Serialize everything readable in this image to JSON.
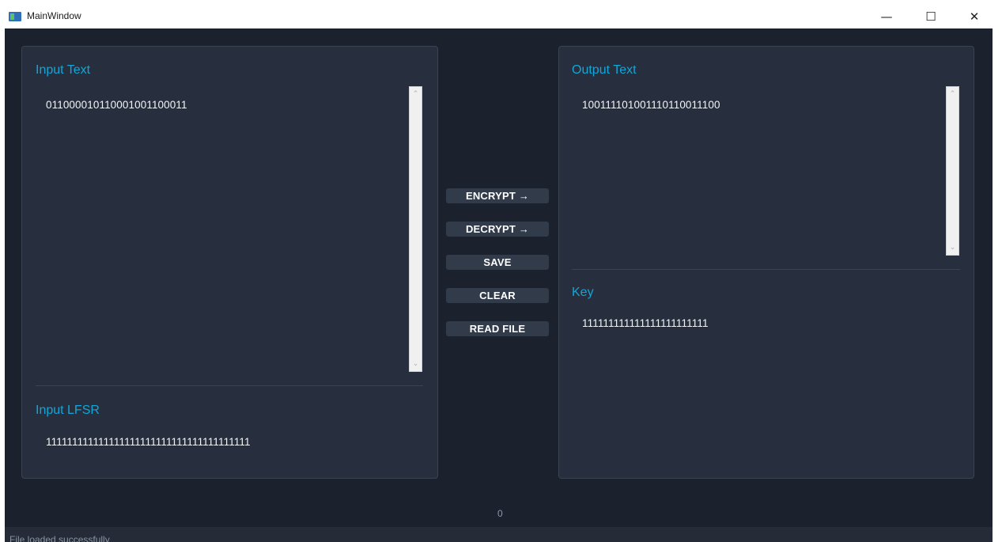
{
  "window": {
    "title": "MainWindow",
    "minimize_glyph": "—",
    "maximize_glyph": "☐",
    "close_glyph": "✕"
  },
  "input_panel": {
    "text_label": "Input Text",
    "text_value": "011000010110001001100011",
    "lfsr_label": "Input LFSR",
    "lfsr_value": "111111111111111111111111111111111111111"
  },
  "output_panel": {
    "text_label": "Output Text",
    "text_value": "100111101001110110011100",
    "key_label": "Key",
    "key_value": "111111111111111111111111"
  },
  "actions": {
    "encrypt": "ENCRYPT →",
    "decrypt": "DECRYPT →",
    "save": "SAVE",
    "clear": "CLEAR",
    "read_file": "READ FILE"
  },
  "counter": "0",
  "status": {
    "message": "File loaded successfully"
  },
  "colors": {
    "background": "#1c222d",
    "panel": "#272f3e",
    "accent": "#12a6d8",
    "button": "#323b4a"
  },
  "icons": {
    "scroll_up": "⌃",
    "scroll_down": "⌄"
  }
}
